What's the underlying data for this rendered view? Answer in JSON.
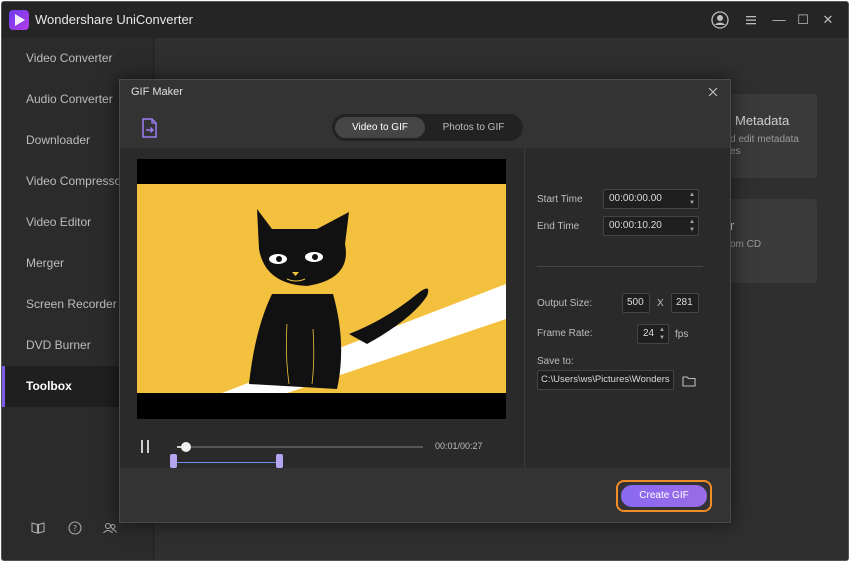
{
  "app": {
    "title": "Wondershare UniConverter"
  },
  "window_controls": {
    "account_icon": "account-icon",
    "menu_icon": "menu-icon",
    "minimize": "—",
    "maximize": "☐",
    "close": "✕"
  },
  "sidebar": {
    "items": [
      {
        "label": "Video Converter",
        "active": false
      },
      {
        "label": "Audio Converter",
        "active": false
      },
      {
        "label": "Downloader",
        "active": false
      },
      {
        "label": "Video Compressor",
        "active": false
      },
      {
        "label": "Video Editor",
        "active": false
      },
      {
        "label": "Merger",
        "active": false
      },
      {
        "label": "Screen Recorder",
        "active": false
      },
      {
        "label": "DVD Burner",
        "active": false
      },
      {
        "label": "Toolbox",
        "active": true
      }
    ],
    "footer_icons": [
      "book-icon",
      "help-icon",
      "users-icon"
    ]
  },
  "background_cards": [
    {
      "title": "Metadata",
      "desc_line1": "d edit metadata",
      "desc_line2": "es"
    },
    {
      "title": "r",
      "desc_line1": "om CD",
      "desc_line2": ""
    }
  ],
  "gif_maker": {
    "title": "GIF Maker",
    "tabs": [
      {
        "label": "Video to GIF",
        "active": true
      },
      {
        "label": "Photos to GIF",
        "active": false
      }
    ],
    "playback": {
      "time": "00:01/00:27",
      "progress": 0.037
    },
    "start_time_label": "Start Time",
    "start_time": "00:00:00.00",
    "end_time_label": "End Time",
    "end_time": "00:00:10.20",
    "output_size_label": "Output Size:",
    "output_width": "500",
    "size_separator": "X",
    "output_height": "281",
    "frame_rate_label": "Frame Rate:",
    "frame_rate": "24",
    "fps_label": "fps",
    "save_to_label": "Save to:",
    "save_path": "C:\\Users\\ws\\Pictures\\Wonders",
    "create_button": "Create GIF"
  },
  "colors": {
    "accent": "#8a6af2",
    "highlight_ring": "#f28c28",
    "video_bg": "#f3c13d"
  }
}
